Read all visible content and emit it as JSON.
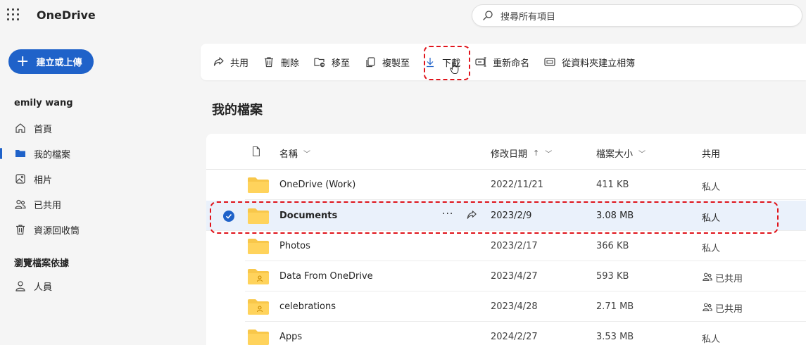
{
  "app": {
    "title": "OneDrive"
  },
  "search": {
    "placeholder": "搜尋所有項目"
  },
  "nav": {
    "new_button": "建立或上傳",
    "user_name": "emily wang",
    "items": [
      {
        "label": "首頁",
        "icon": "home-icon"
      },
      {
        "label": "我的檔案",
        "icon": "folder-icon"
      },
      {
        "label": "相片",
        "icon": "photo-icon"
      },
      {
        "label": "已共用",
        "icon": "people-icon"
      },
      {
        "label": "資源回收筒",
        "icon": "trash-icon"
      }
    ],
    "browse_header": "瀏覽檔案依據",
    "browse_items": [
      {
        "label": "人員",
        "icon": "person-icon"
      }
    ]
  },
  "toolbar": {
    "share": "共用",
    "delete": "刪除",
    "move": "移至",
    "copy": "複製至",
    "download": "下載",
    "rename": "重新命名",
    "album": "從資料夾建立相簿"
  },
  "page": {
    "title": "我的檔案"
  },
  "table": {
    "columns": {
      "name": "名稱",
      "modified": "修改日期",
      "size": "檔案大小",
      "sharing": "共用"
    },
    "rows": [
      {
        "name": "OneDrive (Work)",
        "modified": "2022/11/21",
        "size": "411 KB",
        "sharing": "私人",
        "shared": false,
        "selected": false
      },
      {
        "name": "Documents",
        "modified": "2023/2/9",
        "size": "3.08 MB",
        "sharing": "私人",
        "shared": false,
        "selected": true
      },
      {
        "name": "Photos",
        "modified": "2023/2/17",
        "size": "366 KB",
        "sharing": "私人",
        "shared": false,
        "selected": false
      },
      {
        "name": "Data From OneDrive",
        "modified": "2023/4/27",
        "size": "593 KB",
        "sharing": "已共用",
        "shared": true,
        "selected": false
      },
      {
        "name": "celebrations",
        "modified": "2023/4/28",
        "size": "2.71 MB",
        "sharing": "已共用",
        "shared": true,
        "selected": false
      },
      {
        "name": "Apps",
        "modified": "2024/2/27",
        "size": "3.53 MB",
        "sharing": "私人",
        "shared": false,
        "selected": false
      }
    ]
  },
  "colors": {
    "accent": "#1f62c9",
    "folder": "#f8c74a",
    "highlight": "#e0141b"
  }
}
